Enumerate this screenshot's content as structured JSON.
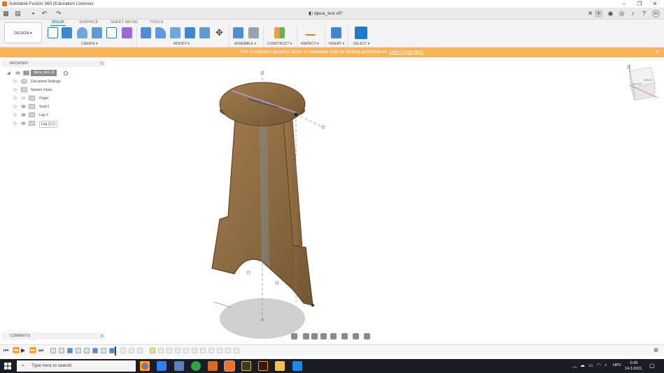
{
  "window": {
    "title": "Autodesk Fusion 360 (Education License)",
    "controls": [
      "–",
      "❐",
      "✕"
    ]
  },
  "tabbar": {
    "doc_title": "djeca_test v5*",
    "user_initials": "IM"
  },
  "ribbon": {
    "tabs": [
      "SOLID",
      "SURFACE",
      "SHEET METAL",
      "TOOLS"
    ],
    "active_tab": "SOLID",
    "workspace": "DESIGN ▾",
    "groups": [
      "CREATE ▾",
      "MODIFY ▾",
      "ASSEMBLE ▾",
      "CONSTRUCT ▾",
      "INSPECT ▾",
      "INSERT ▾",
      "SELECT ▾"
    ]
  },
  "warning": {
    "message": "This computer's graphics driver or hardware may be limiting performance.",
    "link": "Learn more here."
  },
  "browser": {
    "title": "BROWSER",
    "root": "djeca_test v5",
    "items": [
      {
        "label": "Document Settings",
        "icon": "gear-icon"
      },
      {
        "label": "Named Views",
        "icon": "folder-icon"
      },
      {
        "label": "Origin",
        "icon": "folder-icon"
      },
      {
        "label": "Seat:1",
        "icon": "component-icon"
      },
      {
        "label": "Leg:1",
        "icon": "component-icon"
      },
      {
        "label": "Leg (1):1",
        "icon": "component-icon"
      }
    ]
  },
  "comments": {
    "title": "COMMENTS"
  },
  "viewcube": {
    "labels": [
      "FRONT",
      "RIGHT"
    ],
    "axis": "Z"
  },
  "taskbar": {
    "search_placeholder": "Type here to search",
    "language": "HRV",
    "time": "0:39",
    "date": "14.3.2021."
  },
  "colors": {
    "warning": "#f8b358",
    "accent": "#1e7ac8",
    "wood": "#8c6a40",
    "taskbar": "#1b1c24"
  }
}
